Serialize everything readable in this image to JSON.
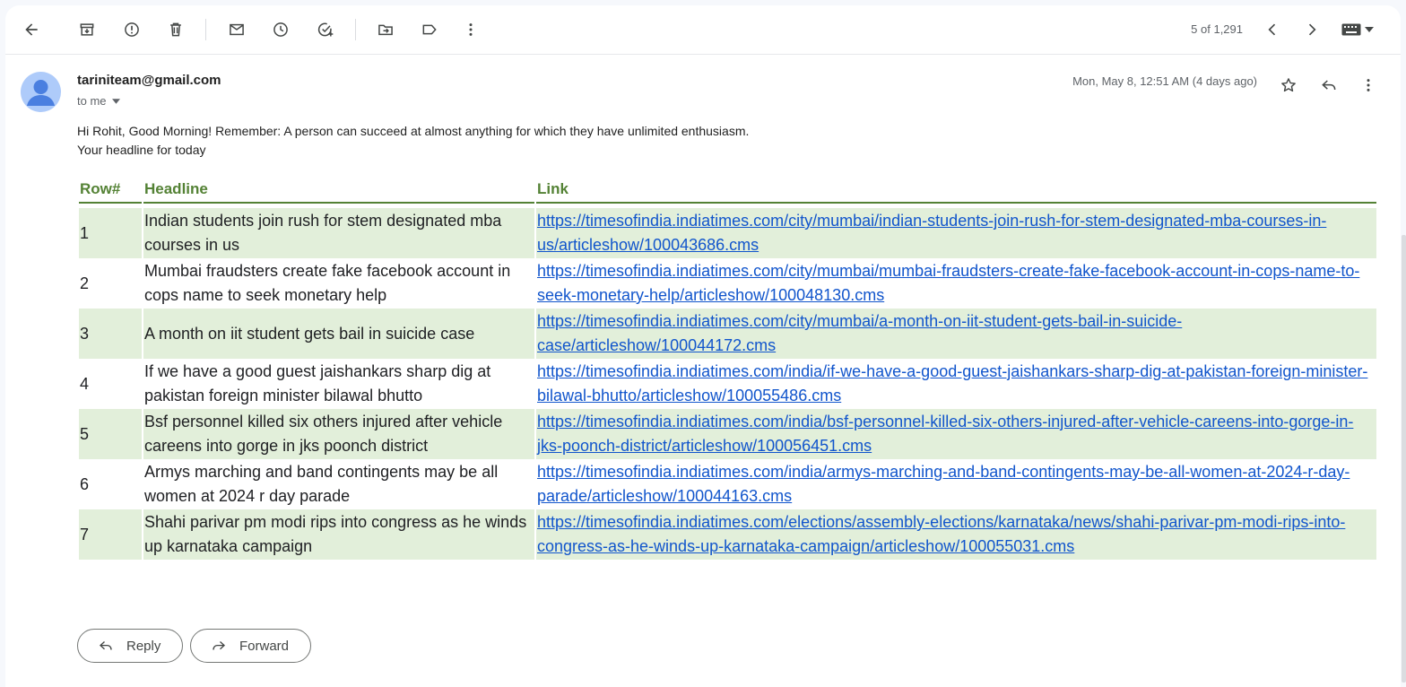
{
  "toolbar": {
    "back": "back-icon",
    "archive": "archive-icon",
    "spam": "report-spam-icon",
    "delete": "delete-icon",
    "unread": "mark-unread-icon",
    "snooze": "snooze-icon",
    "task": "add-task-icon",
    "move": "move-to-icon",
    "label": "label-icon",
    "more": "more-vert-icon",
    "pager_text": "5 of 1,291"
  },
  "email": {
    "sender": "tariniteam@gmail.com",
    "recipient_label": "to me",
    "date": "Mon, May 8, 12:51 AM (4 days ago)",
    "greeting": "Hi Rohit, Good Morning! Remember: A person can succeed at almost anything for which they have unlimited enthusiasm.",
    "intro": "Your headline for today",
    "table": {
      "headers": [
        "Row#",
        "Headline",
        "Link"
      ],
      "rows": [
        {
          "num": "1",
          "headline": "Indian students join rush for stem designated mba courses in us",
          "link": "https://timesofindia.indiatimes.com/city/mumbai/indian-students-join-rush-for-stem-designated-mba-courses-in-us/articleshow/100043686.cms"
        },
        {
          "num": "2",
          "headline": "Mumbai fraudsters create fake facebook account in cops name to seek monetary help",
          "link": "https://timesofindia.indiatimes.com/city/mumbai/mumbai-fraudsters-create-fake-facebook-account-in-cops-name-to-seek-monetary-help/articleshow/100048130.cms"
        },
        {
          "num": "3",
          "headline": "A month on iit student gets bail in suicide case",
          "link": "https://timesofindia.indiatimes.com/city/mumbai/a-month-on-iit-student-gets-bail-in-suicide-case/articleshow/100044172.cms"
        },
        {
          "num": "4",
          "headline": "If we have a good guest jaishankars sharp dig at pakistan foreign minister bilawal bhutto",
          "link": "https://timesofindia.indiatimes.com/india/if-we-have-a-good-guest-jaishankars-sharp-dig-at-pakistan-foreign-minister-bilawal-bhutto/articleshow/100055486.cms"
        },
        {
          "num": "5",
          "headline": "Bsf personnel killed six others injured after vehicle careens into gorge in jks poonch district",
          "link": "https://timesofindia.indiatimes.com/india/bsf-personnel-killed-six-others-injured-after-vehicle-careens-into-gorge-in-jks-poonch-district/articleshow/100056451.cms"
        },
        {
          "num": "6",
          "headline": "Armys marching and band contingents may be all women at 2024 r day parade",
          "link": "https://timesofindia.indiatimes.com/india/armys-marching-and-band-contingents-may-be-all-women-at-2024-r-day-parade/articleshow/100044163.cms"
        },
        {
          "num": "7",
          "headline": "Shahi parivar pm modi rips into congress as he winds up karnataka campaign",
          "link": "https://timesofindia.indiatimes.com/elections/assembly-elections/karnataka/news/shahi-parivar-pm-modi-rips-into-congress-as-he-winds-up-karnataka-campaign/articleshow/100055031.cms"
        }
      ]
    }
  },
  "actions": {
    "reply_label": "Reply",
    "forward_label": "Forward"
  },
  "colors": {
    "table_header": "#548235",
    "alt_row": "#e2efda",
    "link": "#1155cc"
  }
}
